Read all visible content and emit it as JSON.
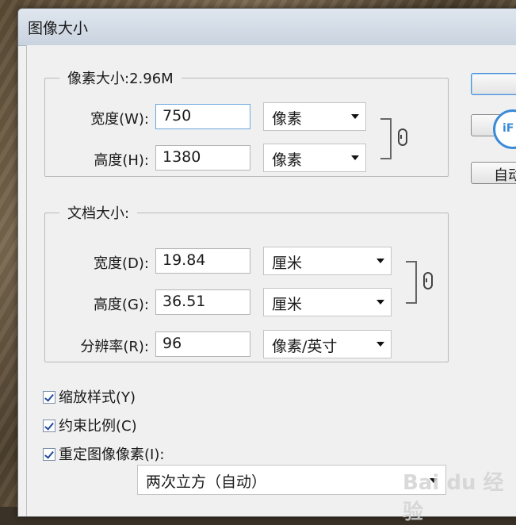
{
  "dialog": {
    "title": "图像大小"
  },
  "pixel_dimensions": {
    "legend": "像素大小:2.96M",
    "width": {
      "label": "宽度(W):",
      "value": "750",
      "unit": "像素"
    },
    "height": {
      "label": "高度(H):",
      "value": "1380",
      "unit": "像素"
    }
  },
  "document_size": {
    "legend": "文档大小:",
    "width": {
      "label": "宽度(D):",
      "value": "19.84",
      "unit": "厘米"
    },
    "height": {
      "label": "高度(G):",
      "value": "36.51",
      "unit": "厘米"
    },
    "resolution": {
      "label": "分辨率(R):",
      "value": "96",
      "unit": "像素/英寸"
    }
  },
  "options": {
    "scale_styles": {
      "label": "缩放样式(Y)",
      "checked": true
    },
    "constrain": {
      "label": "约束比例(C)",
      "checked": true
    },
    "resample": {
      "label": "重定图像像素(I):",
      "checked": true
    }
  },
  "resample_method": "两次立方（自动）",
  "buttons": {
    "auto": "自动"
  },
  "watermark": {
    "badge": "iF",
    "text": "Bai du 经验"
  }
}
